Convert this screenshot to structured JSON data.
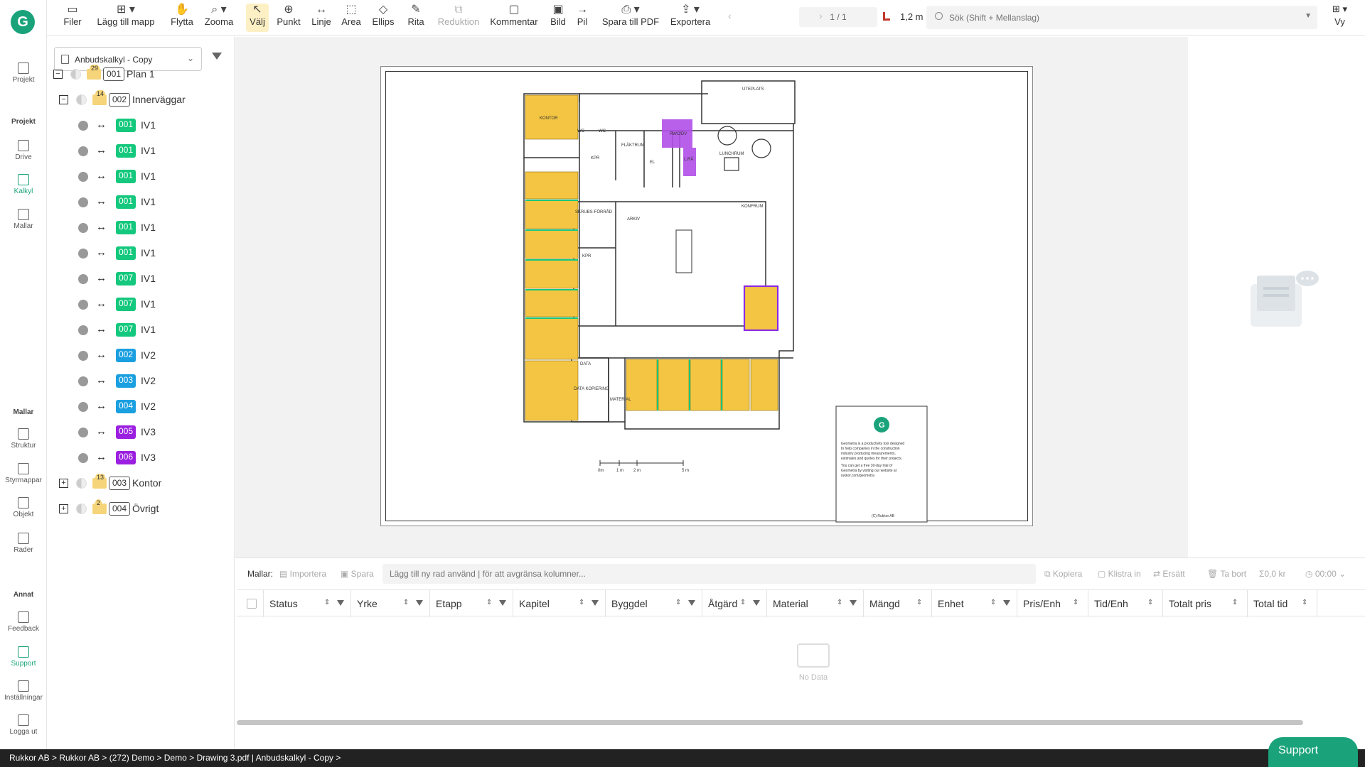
{
  "rail": {
    "top_item": "Projekt",
    "section_projekt": "Projekt",
    "projekt_items": [
      "Drive",
      "Kalkyl",
      "Mallar"
    ],
    "section_mallar": "Mallar",
    "mallar_items": [
      "Struktur",
      "Styrmappar",
      "Objekt",
      "Rader"
    ],
    "section_annat": "Annat",
    "annat_items": [
      "Feedback",
      "Support",
      "Inställningar",
      "Logga ut"
    ],
    "active_item": "Kalkyl"
  },
  "toolbar": {
    "tools": [
      {
        "label": "Filer",
        "icon": "folder-icon"
      },
      {
        "label": "Lägg till mapp",
        "icon": "add-folder-icon"
      },
      {
        "label": "Flytta",
        "icon": "hand-icon"
      },
      {
        "label": "Zooma",
        "icon": "zoom-icon"
      },
      {
        "label": "Välj",
        "icon": "pointer-icon"
      },
      {
        "label": "Punkt",
        "icon": "point-icon"
      },
      {
        "label": "Linje",
        "icon": "line-icon"
      },
      {
        "label": "Area",
        "icon": "area-icon"
      },
      {
        "label": "Ellips",
        "icon": "ellipse-icon"
      },
      {
        "label": "Rita",
        "icon": "pen-icon"
      },
      {
        "label": "Reduktion",
        "icon": "reduction-icon"
      },
      {
        "label": "Kommentar",
        "icon": "comment-icon"
      },
      {
        "label": "Bild",
        "icon": "image-icon"
      },
      {
        "label": "Pil",
        "icon": "arrow-icon"
      },
      {
        "label": "Spara till PDF",
        "icon": "printer-icon"
      },
      {
        "label": "Exportera",
        "icon": "export-icon"
      }
    ],
    "page_indicator": "1 / 1",
    "scale_value": "1,2 m",
    "search_placeholder": "Sök (Shift + Mellanslag)",
    "view_label": "Vy"
  },
  "tree": {
    "calc_select": "Anbudskalkyl - Copy",
    "rows": [
      {
        "type": "folder",
        "code": "001",
        "label": "Plan 1",
        "count": "29",
        "toggle": "−"
      },
      {
        "type": "folder",
        "code": "002",
        "label": "Innerväggar",
        "count": "14",
        "toggle": "−"
      },
      {
        "type": "item",
        "code": "001",
        "label": "IV1",
        "color": "#14c87d"
      },
      {
        "type": "item",
        "code": "001",
        "label": "IV1",
        "color": "#14c87d"
      },
      {
        "type": "item",
        "code": "001",
        "label": "IV1",
        "color": "#14c87d"
      },
      {
        "type": "item",
        "code": "001",
        "label": "IV1",
        "color": "#14c87d"
      },
      {
        "type": "item",
        "code": "001",
        "label": "IV1",
        "color": "#14c87d"
      },
      {
        "type": "item",
        "code": "001",
        "label": "IV1",
        "color": "#14c87d"
      },
      {
        "type": "item",
        "code": "007",
        "label": "IV1",
        "color": "#14c87d"
      },
      {
        "type": "item",
        "code": "007",
        "label": "IV1",
        "color": "#14c87d"
      },
      {
        "type": "item",
        "code": "007",
        "label": "IV1",
        "color": "#14c87d"
      },
      {
        "type": "item",
        "code": "002",
        "label": "IV2",
        "color": "#1a9fe0"
      },
      {
        "type": "item",
        "code": "003",
        "label": "IV2",
        "color": "#1a9fe0"
      },
      {
        "type": "item",
        "code": "004",
        "label": "IV2",
        "color": "#1a9fe0"
      },
      {
        "type": "item",
        "code": "005",
        "label": "IV3",
        "color": "#9b1fe0"
      },
      {
        "type": "item",
        "code": "006",
        "label": "IV3",
        "color": "#9b1fe0"
      },
      {
        "type": "folder",
        "code": "003",
        "label": "Kontor",
        "count": "13",
        "toggle": "+"
      },
      {
        "type": "folder",
        "code": "004",
        "label": "Övrigt",
        "count": "2",
        "toggle": "+"
      }
    ]
  },
  "drawing": {
    "rooms": [
      "UTEPLATS",
      "KONTOR",
      "WC",
      "WC",
      "FLÄKTRUM",
      "KPR",
      "EL",
      "RWC/DV",
      "L.RÅ",
      "LUNCHRUM",
      "KONFRUM",
      "SKRUBS-FÖRRÅD",
      "ARKIV",
      "KPR",
      "DATA",
      "MATERIAL",
      "DATA KOPIERING"
    ],
    "scale_labels": [
      "0m",
      "1 m",
      "2 m",
      "5 m"
    ],
    "titleblock_logo": "G",
    "titleblock_text": [
      "Geometra is a productivity tool designed",
      "to help companies in the construction",
      "industry producing measurements,",
      "estimates and quotes for their projects.",
      "You can get a free 30-day trial of",
      "Geometra by visiting our website at",
      "rukkor.com/geometra"
    ],
    "titleblock_copyright": "(C) Rukkor AB"
  },
  "grid": {
    "mallar_label": "Mallar:",
    "importera": "Importera",
    "spara": "Spara",
    "row_placeholder": "Lägg till ny rad använd | för att avgränsa kolumner...",
    "kopiera": "Kopiera",
    "klistra_in": "Klistra in",
    "ersatt": "Ersätt",
    "ta_bort": "Ta bort",
    "sum_price": "0,0 kr",
    "sum_time": "00:00",
    "columns": [
      {
        "label": "Status",
        "filter": true
      },
      {
        "label": "Yrke",
        "filter": true
      },
      {
        "label": "Etapp",
        "filter": true
      },
      {
        "label": "Kapitel",
        "filter": true
      },
      {
        "label": "Byggdel",
        "filter": true
      },
      {
        "label": "Åtgärd",
        "filter": true
      },
      {
        "label": "Material",
        "filter": true
      },
      {
        "label": "Mängd",
        "filter": false
      },
      {
        "label": "Enhet",
        "filter": true
      },
      {
        "label": "Pris/Enh",
        "filter": false
      },
      {
        "label": "Tid/Enh",
        "filter": false
      },
      {
        "label": "Totalt pris",
        "filter": false
      },
      {
        "label": "Total tid",
        "filter": false
      }
    ],
    "no_data": "No Data"
  },
  "statusbar": {
    "breadcrumb": "Rukkor AB > Rukkor AB > (272) Demo > Demo > Drawing 3.pdf   |   Anbudskalkyl - Copy >"
  },
  "support_button": "Support",
  "colors": {
    "accent": "#1aa37a",
    "room_fill": "#f4c542",
    "purple": "#b24fe8",
    "green_wall": "#14c87d"
  }
}
